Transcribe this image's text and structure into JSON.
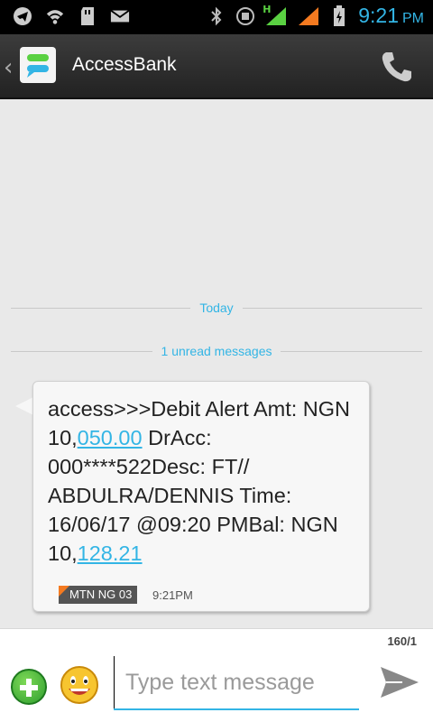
{
  "status_bar": {
    "time": "9:21",
    "ampm": "PM",
    "network_type": "H"
  },
  "header": {
    "title": "AccessBank"
  },
  "conversation": {
    "date_divider": "Today",
    "unread_divider": "1 unread messages",
    "message": {
      "text_1": "access>>>Debit Alert Amt: NGN 10,",
      "link_1": "050.00",
      "text_2": " DrAcc: 000****522Desc: FT// ABDULRA/DENNIS Time: 16/06/17 @09:20 PMBal: NGN 10,",
      "link_2": "128.21",
      "sim_label": "MTN NG 03",
      "time": "9:21PM"
    }
  },
  "compose": {
    "char_counter": "160/1",
    "placeholder": "Type text message"
  },
  "colors": {
    "accent": "#33b5e5",
    "sim_badge": "#f47a20",
    "add_green": "#2e9e2e"
  },
  "icons": [
    "telegram-icon",
    "wifi-icon",
    "sd-card-icon",
    "mail-icon",
    "bluetooth-icon",
    "usb-icon",
    "signal-icon",
    "battery-icon",
    "messaging-app-icon",
    "phone-icon",
    "add-icon",
    "smiley-icon",
    "send-icon"
  ]
}
